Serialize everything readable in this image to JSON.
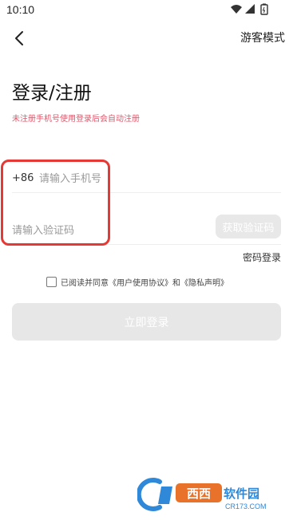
{
  "status_bar": {
    "time": "10:10",
    "icons": [
      "wifi-icon",
      "signal-icon",
      "battery-icon"
    ]
  },
  "nav": {
    "back_icon": "chevron-left-icon",
    "guest_mode_label": "游客模式"
  },
  "header": {
    "title": "登录/注册",
    "subtitle": "未注册手机号使用登录后会自动注册"
  },
  "form": {
    "phone_prefix": "+86",
    "phone_placeholder": "请输入手机号",
    "phone_value": "",
    "code_placeholder": "请输入验证码",
    "code_value": "",
    "get_code_label": "获取验证码",
    "password_login_label": "密码登录"
  },
  "agreement": {
    "checked": false,
    "prefix": "已阅读并同意",
    "user_agreement": "《用户使用协议》",
    "and": "和",
    "privacy_policy": "《隐私声明》"
  },
  "login_button_label": "立即登录",
  "watermark": {
    "brand": "西西软件园",
    "site": "CR173.COM"
  },
  "colors": {
    "subtitle": "#e2566a",
    "highlight_border": "#e53935",
    "disabled_button_bg": "#e7e7e7",
    "divider": "#eeeeee"
  }
}
